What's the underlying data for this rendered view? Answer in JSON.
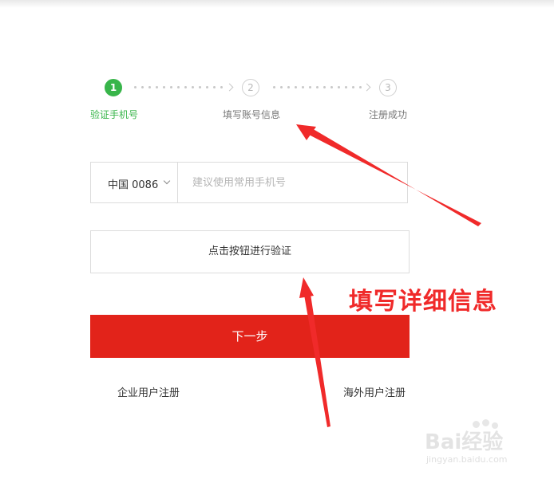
{
  "steps": [
    {
      "number": "1",
      "label": "验证手机号",
      "state": "active"
    },
    {
      "number": "2",
      "label": "填写账号信息",
      "state": "inactive"
    },
    {
      "number": "3",
      "label": "注册成功",
      "state": "inactive"
    }
  ],
  "phone": {
    "country_code": "中国 0086",
    "placeholder": "建议使用常用手机号"
  },
  "verify_button": {
    "label": "点击按钮进行验证"
  },
  "next_button": {
    "label": "下一步"
  },
  "links": {
    "enterprise": "企业用户注册",
    "overseas": "海外用户注册"
  },
  "annotation": {
    "text": "填写详细信息",
    "color": "#f02a2a"
  },
  "watermark": {
    "brand": "Bai经验",
    "url": "jingyan.baidu.com"
  },
  "colors": {
    "accent_green": "#38b54a",
    "primary_red": "#e2231a"
  }
}
